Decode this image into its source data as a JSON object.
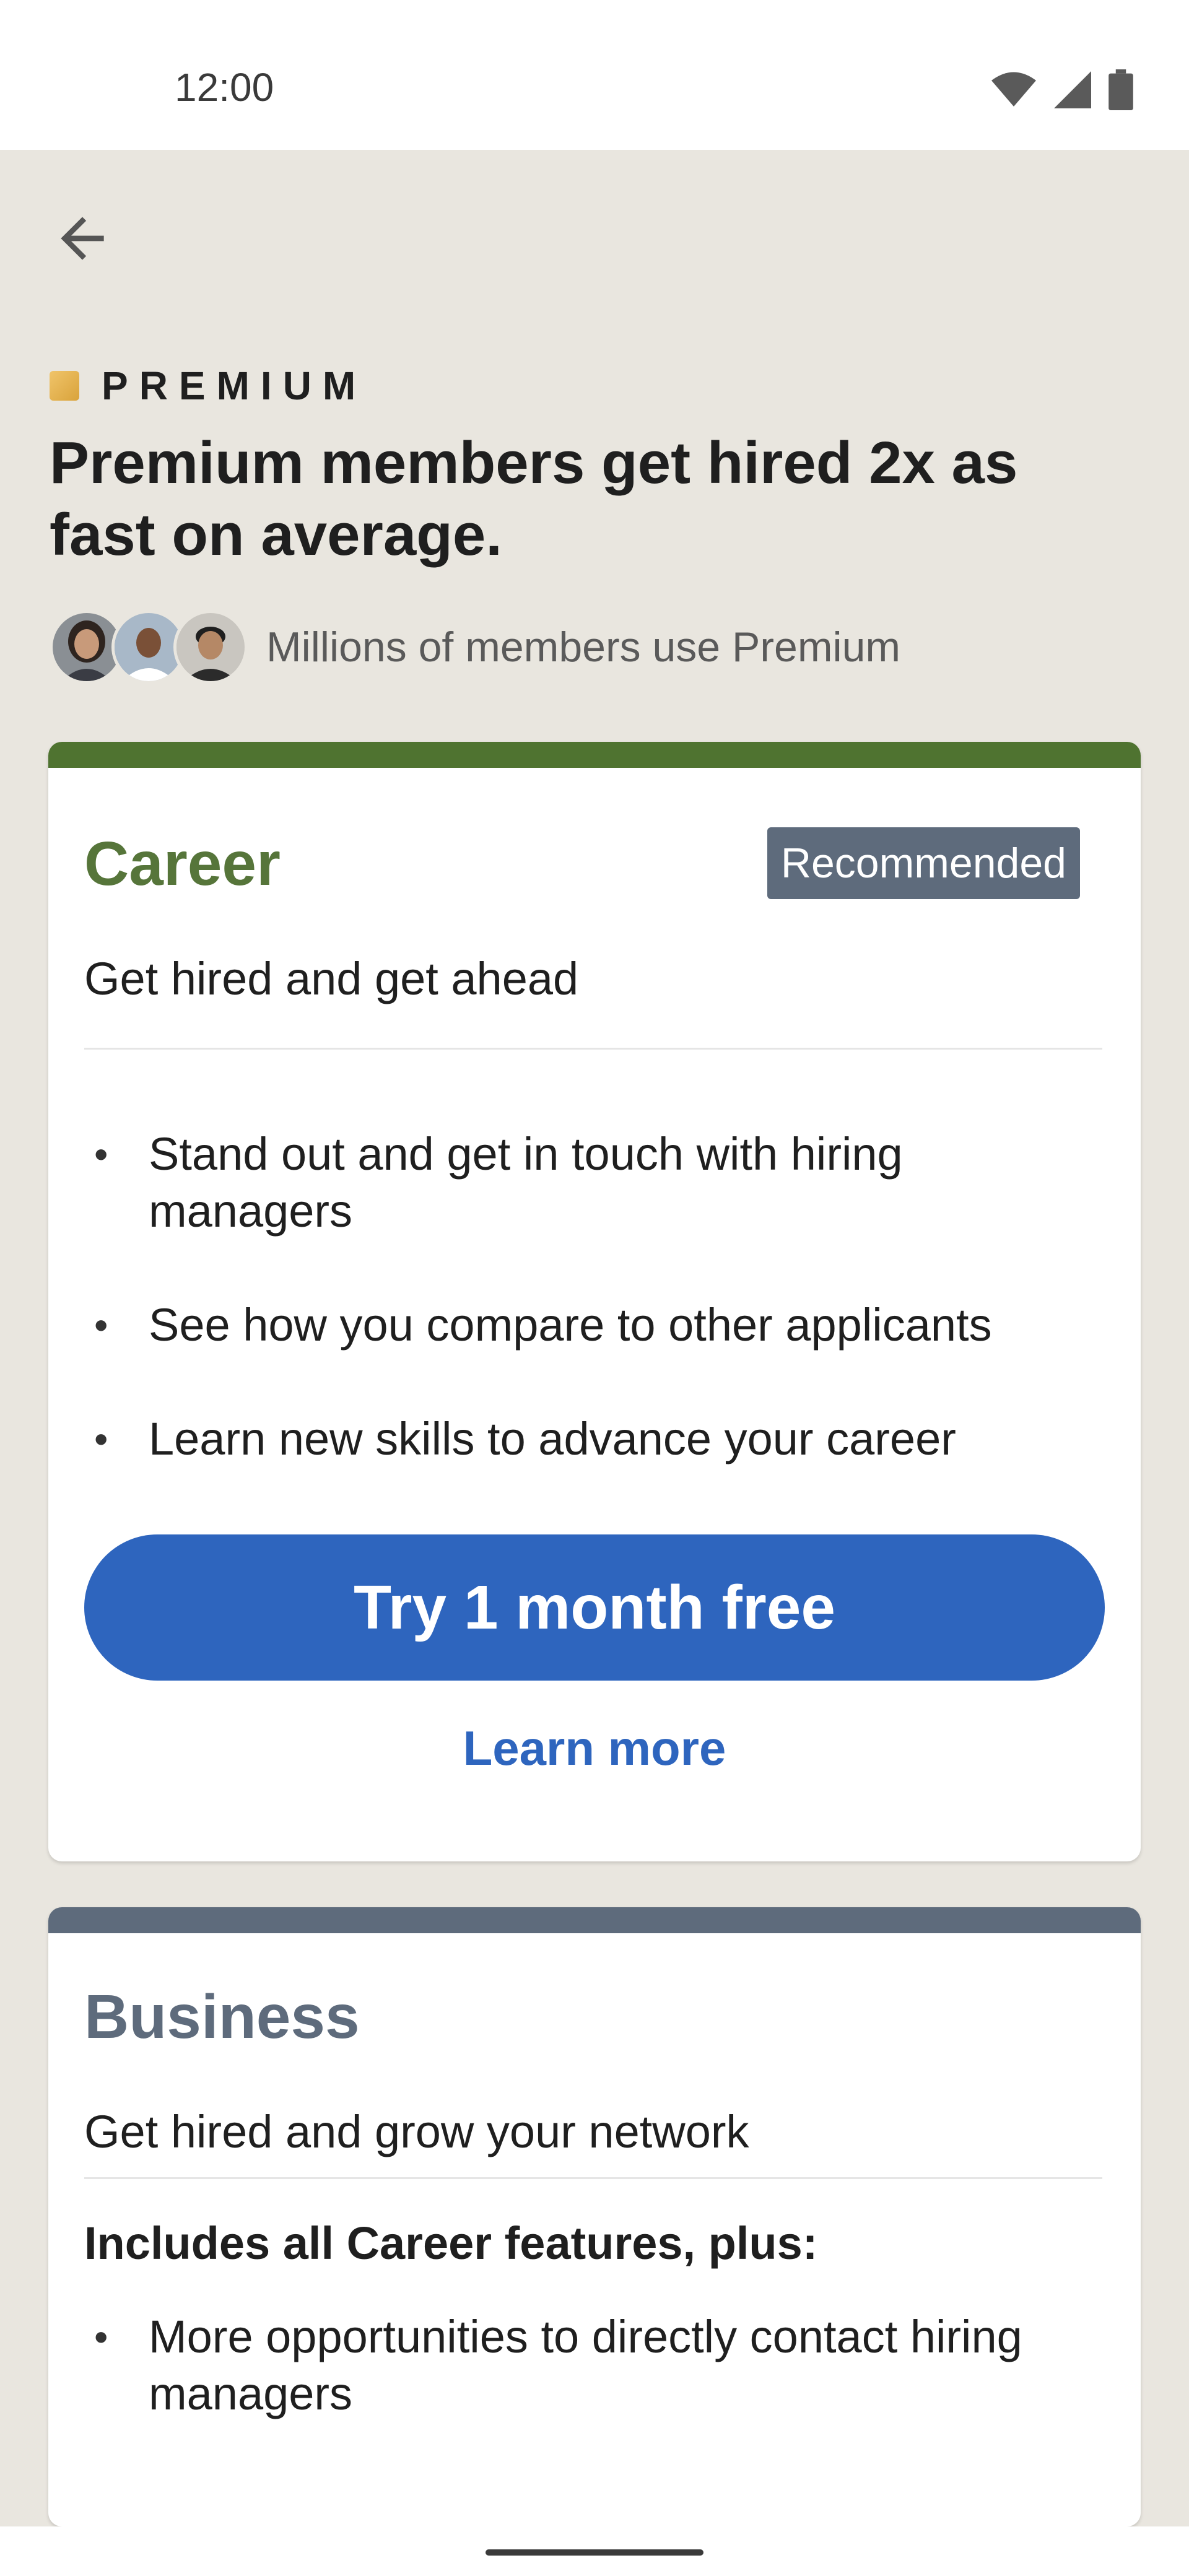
{
  "status_bar": {
    "time": "12:00"
  },
  "header": {
    "premium_label": "PREMIUM",
    "headline": "Premium members get hired 2x as fast on average.",
    "members_text": "Millions of members use Premium"
  },
  "plans": {
    "career": {
      "title": "Career",
      "badge": "Recommended",
      "subtitle": "Get hired and get ahead",
      "features": [
        "Stand out and get in touch with hiring managers",
        "See how you compare to other applicants",
        "Learn new skills to advance your career"
      ],
      "cta": "Try 1 month free",
      "learn_more": "Learn more"
    },
    "business": {
      "title": "Business",
      "subtitle": "Get hired and grow your network",
      "includes": "Includes all Career features, plus:",
      "features": [
        "More opportunities to directly contact hiring managers"
      ]
    }
  },
  "colors": {
    "background": "#e9e6df",
    "career_accent": "#56753a",
    "business_accent": "#5e6b7c",
    "cta": "#2e65be"
  }
}
